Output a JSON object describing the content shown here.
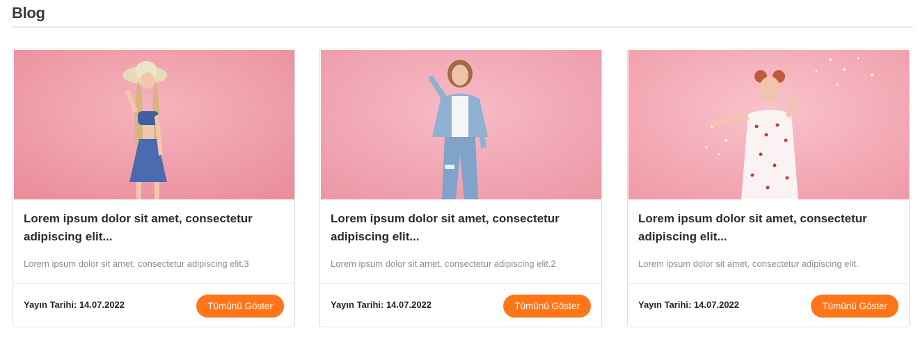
{
  "section": {
    "title": "Blog"
  },
  "colors": {
    "accent": "#ff7518",
    "image_background": "#f2a6b3"
  },
  "posts": [
    {
      "image": "woman-in-sun-hat-denim-dress-photo",
      "title": "Lorem ipsum dolor sit amet, consectetur adipiscing elit...",
      "description": "Lorem ipsum dolor sit amet, consectetur adipiscing elit.3",
      "date_label": "Yayın Tarihi: 14.07.2022",
      "button_label": "Tümünü Göster"
    },
    {
      "image": "woman-in-denim-jacket-photo",
      "title": "Lorem ipsum dolor sit amet, consectetur adipiscing elit...",
      "description": "Lorem ipsum dolor sit amet, consectetur adipiscing elit.2",
      "date_label": "Yayın Tarihi: 14.07.2022",
      "button_label": "Tümünü Göster"
    },
    {
      "image": "woman-in-floral-dress-confetti-photo",
      "title": "Lorem ipsum dolor sit amet, consectetur adipiscing elit...",
      "description": "Lorem ipsum dolor sit amet, consectetur adipiscing elit.",
      "date_label": "Yayın Tarihi: 14.07.2022",
      "button_label": "Tümünü Göster"
    }
  ]
}
